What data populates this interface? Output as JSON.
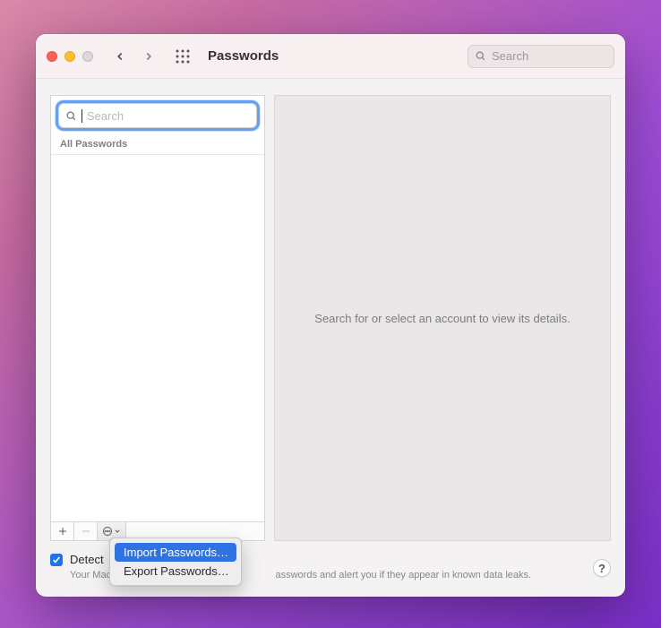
{
  "titlebar": {
    "title": "Passwords",
    "search_placeholder": "Search"
  },
  "sidebar": {
    "search_placeholder": "Search",
    "section_label": "All Passwords"
  },
  "detail": {
    "empty_message": "Search for or select an account to view its details."
  },
  "checkbox": {
    "label_visible": "Detect ",
    "desc_prefix": "Your Mac",
    "desc_suffix": "asswords and alert you if they appear in known data leaks."
  },
  "popup": {
    "items": [
      {
        "label": "Import Passwords…",
        "highlighted": true
      },
      {
        "label": "Export Passwords…",
        "highlighted": false
      }
    ]
  },
  "help": {
    "label": "?"
  }
}
